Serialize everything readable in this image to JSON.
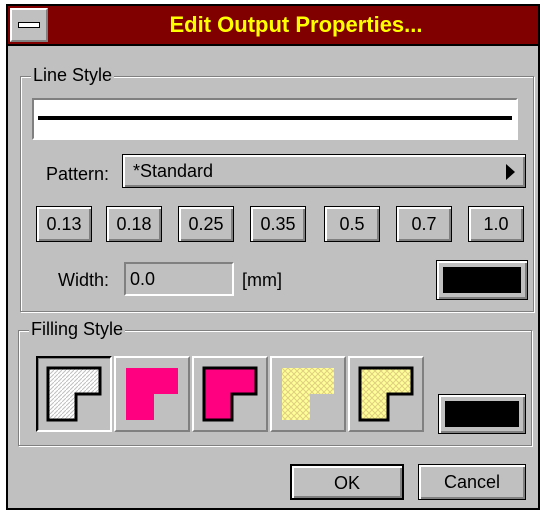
{
  "window": {
    "title": "Edit Output Properties..."
  },
  "line_style": {
    "group_label": "Line Style",
    "pattern_label": "Pattern:",
    "pattern_value": "*Standard",
    "width_presets": [
      "0.13",
      "0.18",
      "0.25",
      "0.35",
      "0.5",
      "0.7",
      "1.0"
    ],
    "width_label": "Width:",
    "width_value": "0.0",
    "width_unit": "[mm]",
    "color": "#000000"
  },
  "filling_style": {
    "group_label": "Filling Style",
    "options": [
      {
        "name": "white-hatch",
        "fill": "#ffffff",
        "pattern": "hatch",
        "outline": "#000000"
      },
      {
        "name": "magenta-solid-no-border",
        "fill": "#ff0080",
        "pattern": "solid",
        "outline": "none"
      },
      {
        "name": "magenta-solid-border",
        "fill": "#ff0080",
        "pattern": "solid",
        "outline": "#000000"
      },
      {
        "name": "yellow-hatch-no-border",
        "fill": "#ffff99",
        "pattern": "crosshatch",
        "outline": "none"
      },
      {
        "name": "yellow-hatch-border",
        "fill": "#ffff99",
        "pattern": "crosshatch",
        "outline": "#000000"
      }
    ],
    "selected_index": 0,
    "color": "#000000"
  },
  "buttons": {
    "ok": "OK",
    "cancel": "Cancel"
  },
  "colors": {
    "title_bg": "#800000",
    "title_text": "#ffff00",
    "face": "#c0c0c0"
  }
}
